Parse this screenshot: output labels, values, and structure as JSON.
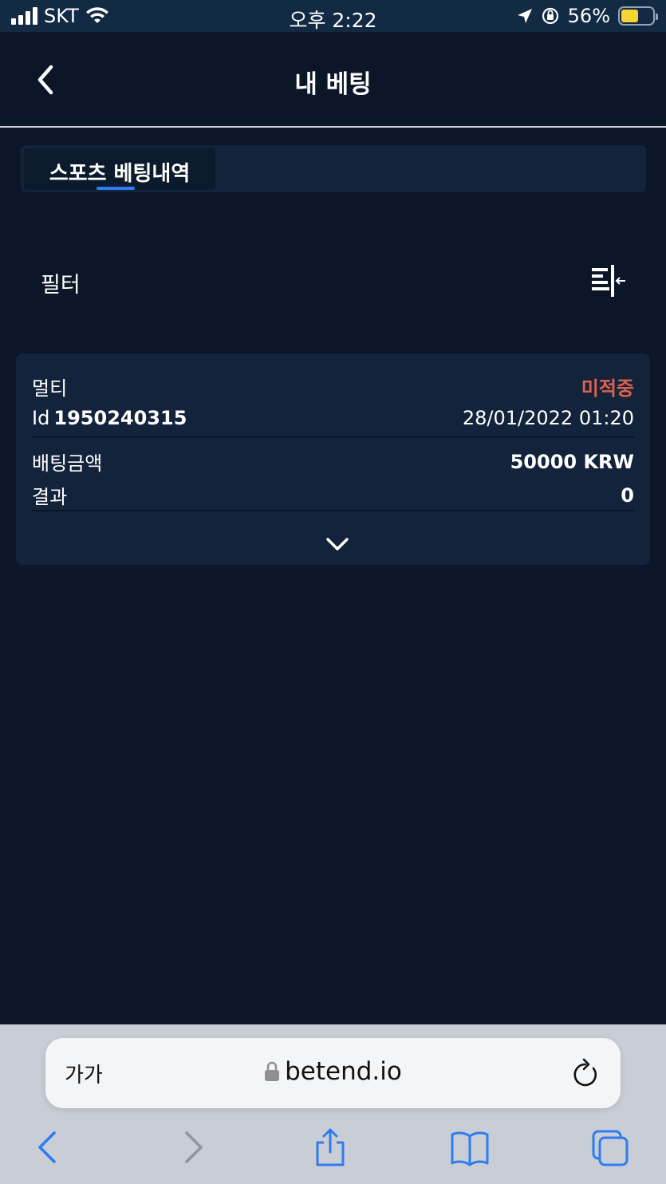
{
  "status_bar": {
    "carrier": "SKT",
    "time": "오후 2:22",
    "battery": "56%",
    "battery_level": 0.56
  },
  "header": {
    "title": "내 베팅"
  },
  "tabs": [
    {
      "label": "스포츠 베팅내역",
      "active": true
    }
  ],
  "filter": {
    "label": "필터"
  },
  "bet": {
    "type": "멀티",
    "status": "미적중",
    "status_color": "#e0624e",
    "id_label": "Id",
    "id_value": "1950240315",
    "datetime": "28/01/2022 01:20",
    "amount_label": "배팅금액",
    "amount_value": "50000 KRW",
    "result_label": "결과",
    "result_value": "0"
  },
  "browser": {
    "text_size_button": "가가",
    "url": "betend.io"
  },
  "colors": {
    "background": "#0b1728",
    "card": "#13233b",
    "accent": "#2f7cf0",
    "browser_icon": "#2f7cf0"
  }
}
